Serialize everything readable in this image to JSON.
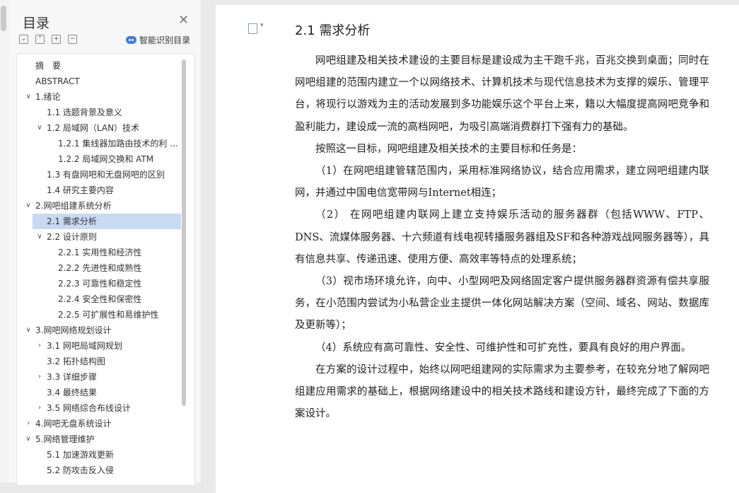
{
  "toc": {
    "title": "目录",
    "smart_label": "智能识别目录",
    "items": [
      {
        "label": "摘　要",
        "chev": ""
      },
      {
        "label": "ABSTRACT",
        "chev": ""
      },
      {
        "label": "1.绪论",
        "chev": "v"
      },
      {
        "label": "1.1 选题背景及意义",
        "chev": ""
      },
      {
        "label": "1.2 局域网（LAN）技术",
        "chev": "v"
      },
      {
        "label": "1.2.1 集线器加路由技术的利 ...",
        "chev": ""
      },
      {
        "label": "1.2.2 局域网交换和 ATM",
        "chev": ""
      },
      {
        "label": "1.3 有盘网吧和无盘网吧的区别",
        "chev": ""
      },
      {
        "label": "1.4 研究主要内容",
        "chev": ""
      },
      {
        "label": "2.网吧组建系统分析",
        "chev": "v"
      },
      {
        "label": "2.1 需求分析",
        "chev": "",
        "selected": true
      },
      {
        "label": "2.2 设计原则",
        "chev": "v"
      },
      {
        "label": "2.2.1 实用性和经济性",
        "chev": ""
      },
      {
        "label": "2.2.2 先进性和成熟性",
        "chev": ""
      },
      {
        "label": "2.2.3 可靠性和稳定性",
        "chev": ""
      },
      {
        "label": "2.2.4 安全性和保密性",
        "chev": ""
      },
      {
        "label": "2.2.5 可扩展性和易维护性",
        "chev": ""
      },
      {
        "label": "3.网吧网络规划设计",
        "chev": "v"
      },
      {
        "label": "3.1 网吧局域网规划",
        "chev": ">"
      },
      {
        "label": "3.2 拓扑结构图",
        "chev": ""
      },
      {
        "label": "3.3 详细步骤",
        "chev": ">"
      },
      {
        "label": "3.4 最终结果",
        "chev": ""
      },
      {
        "label": "3.5 网络综合布线设计",
        "chev": ">"
      },
      {
        "label": "4.网吧无盘系统设计",
        "chev": ">"
      },
      {
        "label": "5.网络管理维护",
        "chev": "v"
      },
      {
        "label": "5.1 加速游戏更新",
        "chev": ""
      },
      {
        "label": "5.2 防攻击反入侵",
        "chev": ""
      }
    ]
  },
  "document": {
    "heading": "2.1 需求分析",
    "paragraphs": [
      "网吧组建及相关技术建设的主要目标是建设成为主干跑千兆，百兆交换到桌面；同时在网吧组建的范围内建立一个以网络技术、计算机技术与现代信息技术为支撑的娱乐、管理平台，将现行以游戏为主的活动发展到多功能娱乐这个平台上来，籍以大幅度提高网吧竞争和盈利能力，建设成一流的高档网吧，为吸引高端消费群打下强有力的基础。",
      "按照这一目标，网吧组建及相关技术的主要目标和任务是：",
      "（1）在网吧组建管辖范围内，采用标准网络协议，结合应用需求，建立网吧组建内联网，并通过中国电信宽带网与Internet相连；",
      "（2）  在网吧组建内联网上建立支持娱乐活动的服务器群（包括WWW、FTP、DNS、流媒体服务器、十六频道有线电视转播服务器组及SF和各种游戏战网服务器等），具有信息共享、传递迅速、使用方便、高效率等特点的处理系统；",
      "（3）视市场环境允许，向中、小型网吧及网络固定客户提供服务器群资源有偿共享服务，在小范围内尝试为小私营企业主提供一体化网站解决方案（空间、域名、网站、数据库及更新等）；",
      "（4）系统应有高可靠性、安全性、可维护性和可扩充性，要具有良好的用户界面。",
      "在方案的设计过程中，始终以网吧组建网的实际需求为主要参考，在较充分地了解网吧组建应用需求的基础上，根据网络建设中的相关技术路线和建设方针，最终完成了下面的方案设计。"
    ]
  }
}
